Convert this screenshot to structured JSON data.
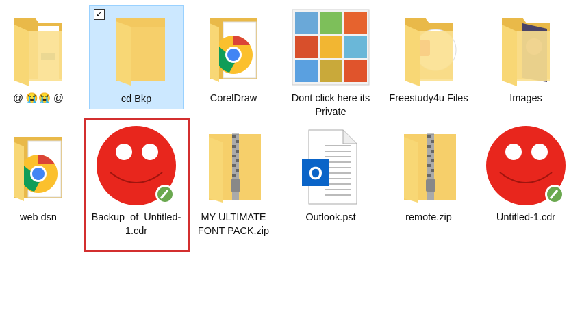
{
  "items": [
    {
      "label": "@ 😭😭 @",
      "type": "folder-docs"
    },
    {
      "label": "cd Bkp",
      "type": "folder-empty",
      "selected": true
    },
    {
      "label": "CorelDraw",
      "type": "folder-chrome"
    },
    {
      "label": "Dont click here its Private",
      "type": "image-grid"
    },
    {
      "label": "Freestudy4u Files",
      "type": "folder-doc"
    },
    {
      "label": "Images",
      "type": "folder-image"
    },
    {
      "label": "web dsn",
      "type": "folder-chrome"
    },
    {
      "label": "Backup_of_Untitled-1.cdr",
      "type": "cdr",
      "highlighted": true
    },
    {
      "label": "MY ULTIMATE FONT PACK.zip",
      "type": "zip"
    },
    {
      "label": "Outlook.pst",
      "type": "pst"
    },
    {
      "label": "remote.zip",
      "type": "zip"
    },
    {
      "label": "Untitled-1.cdr",
      "type": "cdr"
    }
  ],
  "colors": {
    "folder": "#f8d775",
    "selection": "#cce8ff",
    "highlight": "#d32f2f",
    "cdr": "#e8261d",
    "outlook": "#0a64c8"
  }
}
